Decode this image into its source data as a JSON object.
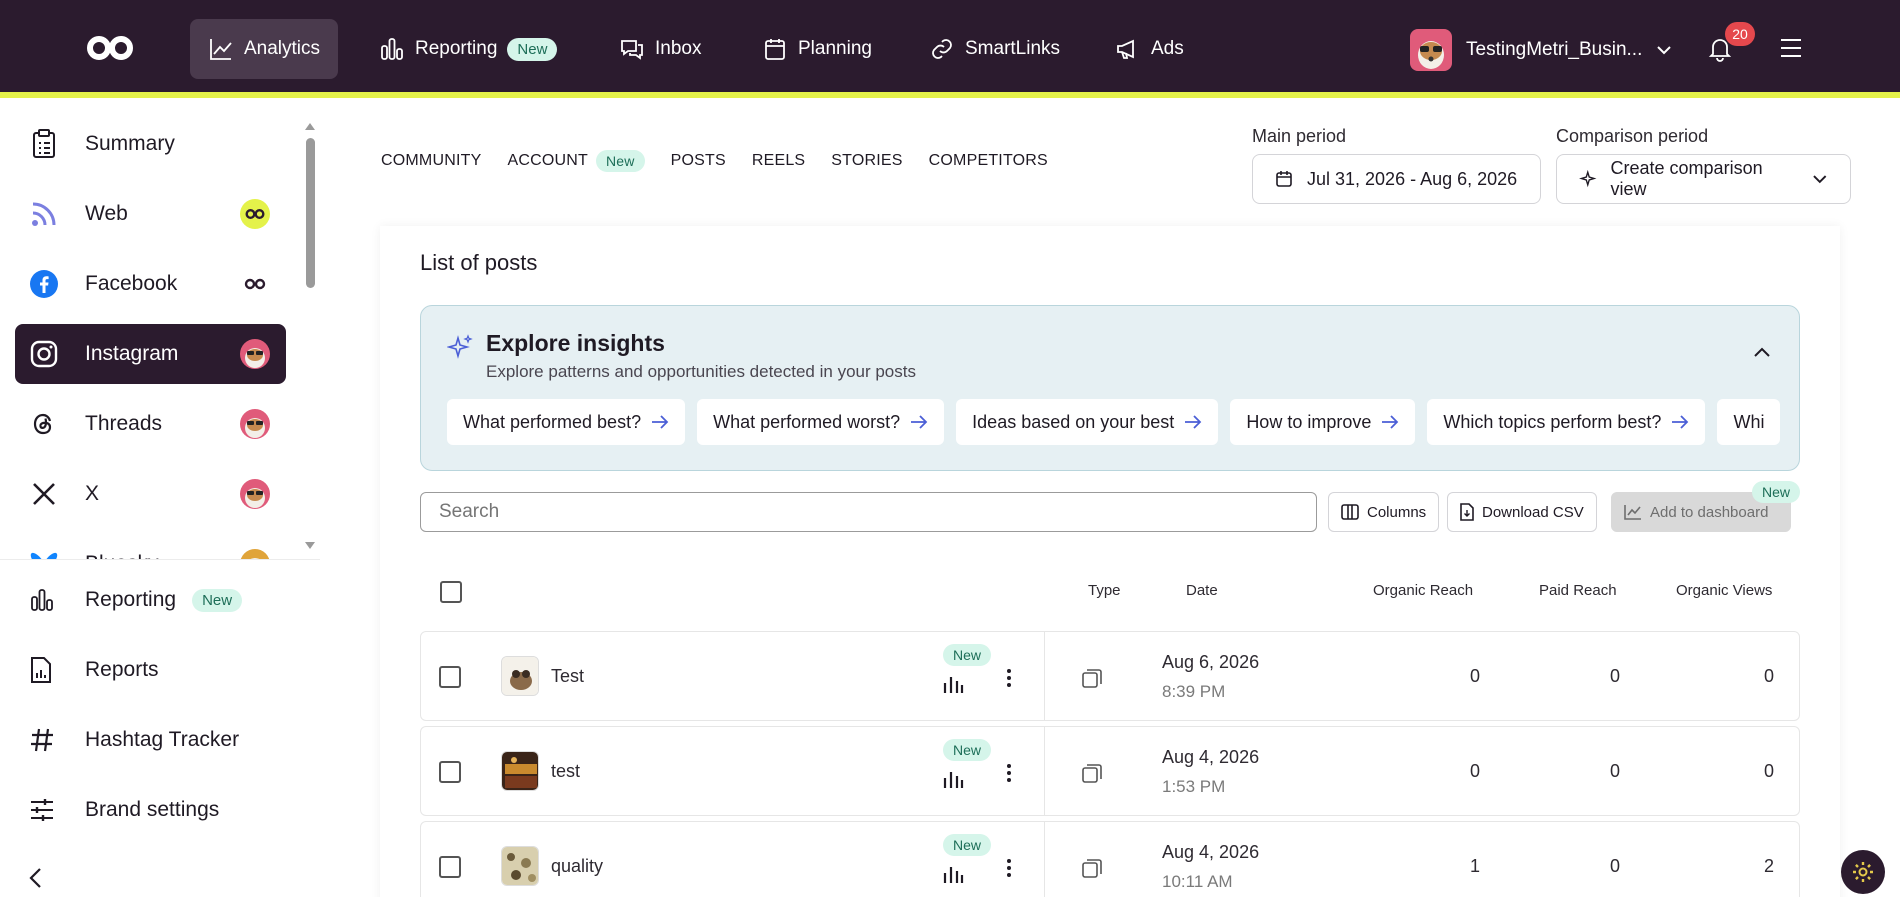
{
  "topnav": {
    "items": [
      {
        "label": "Analytics",
        "icon": "analytics-icon"
      },
      {
        "label": "Reporting",
        "badge": "New",
        "icon": "reporting-icon"
      },
      {
        "label": "Inbox",
        "icon": "inbox-icon"
      },
      {
        "label": "Planning",
        "icon": "calendar-icon"
      },
      {
        "label": "SmartLinks",
        "icon": "link-icon"
      },
      {
        "label": "Ads",
        "icon": "megaphone-icon"
      }
    ],
    "account_name": "TestingMetri_Busin...",
    "notification_count": "20"
  },
  "sidebar": {
    "items": [
      {
        "label": "Summary"
      },
      {
        "label": "Web"
      },
      {
        "label": "Facebook"
      },
      {
        "label": "Instagram"
      },
      {
        "label": "Threads"
      },
      {
        "label": "X"
      },
      {
        "label": "Bluesky"
      }
    ],
    "bottom": [
      {
        "label": "Reporting",
        "badge": "New"
      },
      {
        "label": "Reports"
      },
      {
        "label": "Hashtag Tracker"
      },
      {
        "label": "Brand settings"
      }
    ]
  },
  "subnav": {
    "tabs": [
      "COMMUNITY",
      "ACCOUNT",
      "POSTS",
      "REELS",
      "STORIES",
      "COMPETITORS"
    ],
    "account_badge": "New"
  },
  "period": {
    "main_label": "Main period",
    "main_value": "Jul 31, 2026 - Aug 6, 2026",
    "comparison_label": "Comparison period",
    "comparison_value": "Create comparison view"
  },
  "posts": {
    "title": "List of posts",
    "insights": {
      "title": "Explore insights",
      "subtitle": "Explore patterns and opportunities detected in your posts",
      "chips": [
        "What performed best?",
        "What performed worst?",
        "Ideas based on your best",
        "How to improve",
        "Which topics perform best?",
        "Whi"
      ]
    },
    "search_placeholder": "Search",
    "columns_label": "Columns",
    "download_label": "Download CSV",
    "add_dashboard_label": "Add to dashboard",
    "add_dashboard_badge": "New",
    "headers": {
      "type": "Type",
      "date": "Date",
      "organic_reach": "Organic Reach",
      "paid_reach": "Paid Reach",
      "organic_views": "Organic Views"
    },
    "rows": [
      {
        "title": "Test",
        "badge": "New",
        "date": "Aug 6, 2026",
        "time": "8:39 PM",
        "organic_reach": "0",
        "paid_reach": "0",
        "organic_views": "0"
      },
      {
        "title": "test",
        "badge": "New",
        "date": "Aug 4, 2026",
        "time": "1:53 PM",
        "organic_reach": "0",
        "paid_reach": "0",
        "organic_views": "0"
      },
      {
        "title": "quality",
        "badge": "New",
        "date": "Aug 4, 2026",
        "time": "10:11 AM",
        "organic_reach": "1",
        "paid_reach": "0",
        "organic_views": "2"
      }
    ]
  },
  "colors": {
    "topbar": "#2b1b2e",
    "accent": "#e4f24a",
    "new_badge_bg": "#d5f5ea",
    "notification": "#e5484d"
  }
}
